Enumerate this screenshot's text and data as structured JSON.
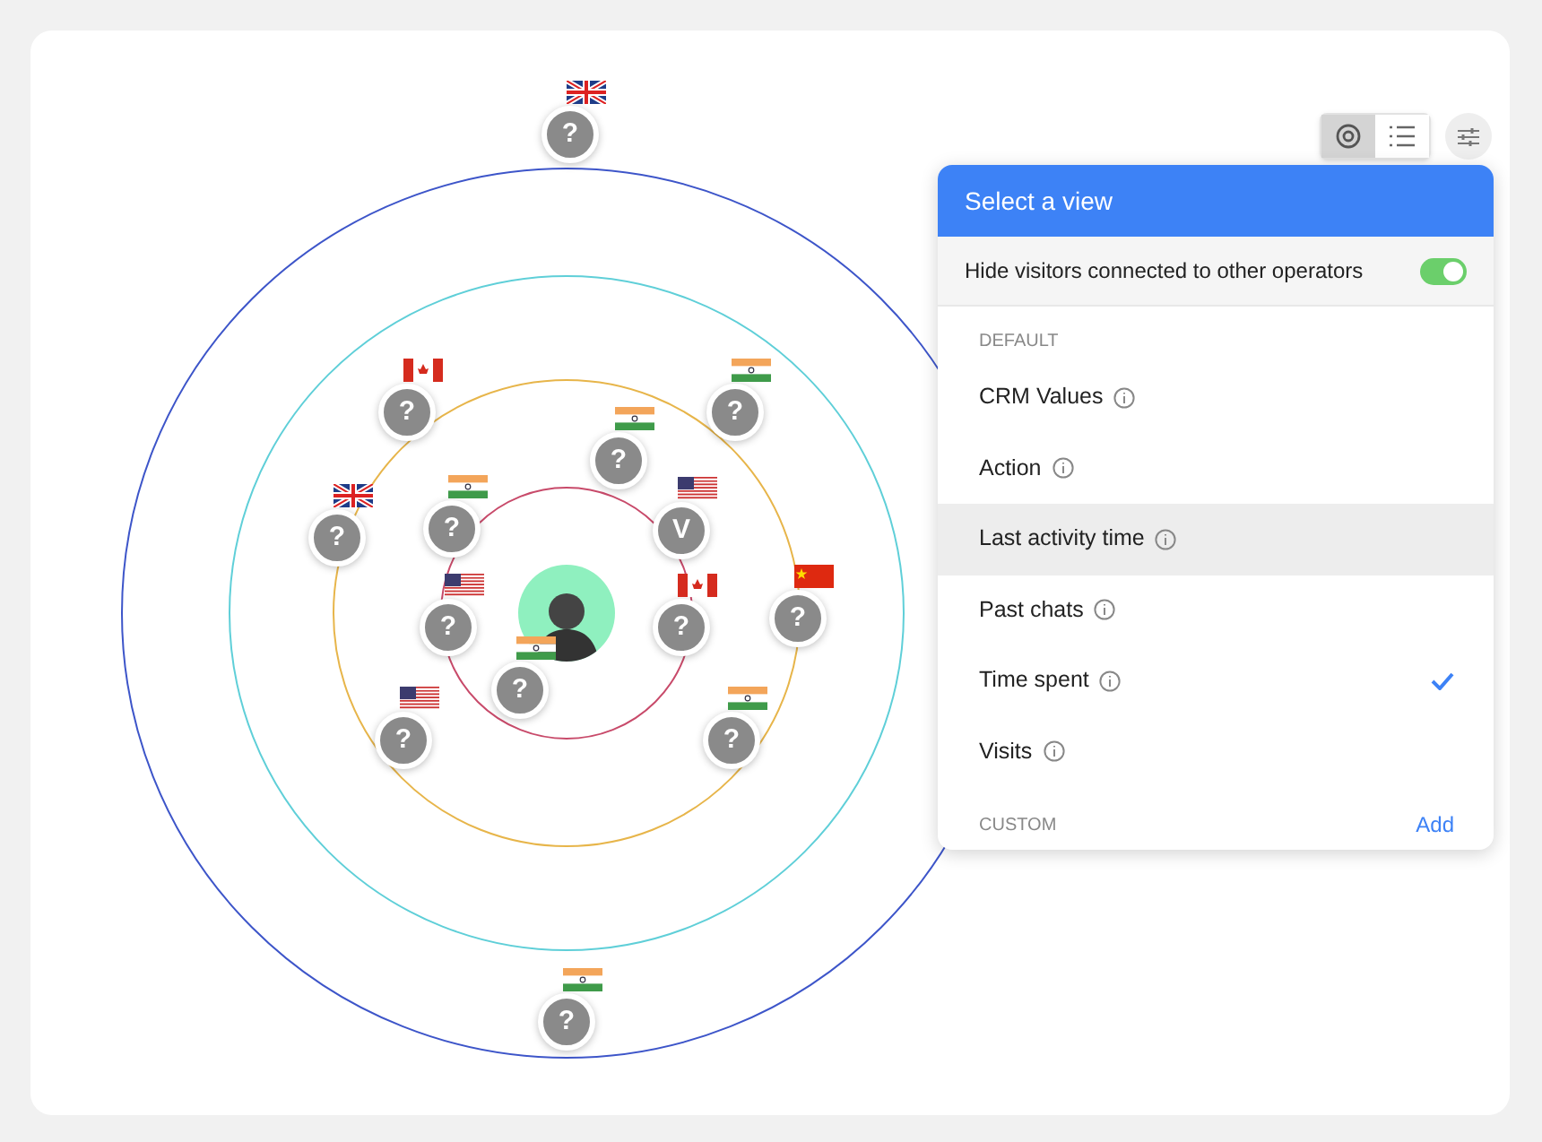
{
  "toolbar": {
    "view_toggle": [
      {
        "kind": "orbit",
        "selected": true
      },
      {
        "kind": "list",
        "selected": false
      }
    ]
  },
  "visitors": [
    {
      "initial": "?",
      "kind": "uk"
    },
    {
      "initial": "?",
      "kind": "canada"
    },
    {
      "initial": "?",
      "kind": "india"
    },
    {
      "initial": "?",
      "kind": "india"
    },
    {
      "initial": "?",
      "kind": "uk"
    },
    {
      "initial": "?",
      "kind": "india"
    },
    {
      "initial": "V",
      "kind": "usa"
    },
    {
      "initial": "?",
      "kind": "usa"
    },
    {
      "initial": "?",
      "kind": "canada"
    },
    {
      "initial": "?",
      "kind": "china"
    },
    {
      "initial": "?",
      "kind": "india"
    },
    {
      "initial": "?",
      "kind": "usa"
    },
    {
      "initial": "?",
      "kind": "india"
    },
    {
      "initial": "?",
      "kind": "india"
    }
  ],
  "view_panel": {
    "title": "Select a view",
    "hide_option": {
      "label": "Hide visitors connected to other operators",
      "on": true
    },
    "default_heading": "DEFAULT",
    "items": [
      {
        "label": "CRM Values",
        "hovered": false,
        "selected": false
      },
      {
        "label": "Action",
        "hovered": false,
        "selected": false
      },
      {
        "label": "Last activity time",
        "hovered": true,
        "selected": false
      },
      {
        "label": "Past chats",
        "hovered": false,
        "selected": false
      },
      {
        "label": "Time spent",
        "hovered": false,
        "selected": true
      },
      {
        "label": "Visits",
        "hovered": false,
        "selected": false
      }
    ],
    "custom_heading": "CUSTOM",
    "custom_action": "Add"
  }
}
